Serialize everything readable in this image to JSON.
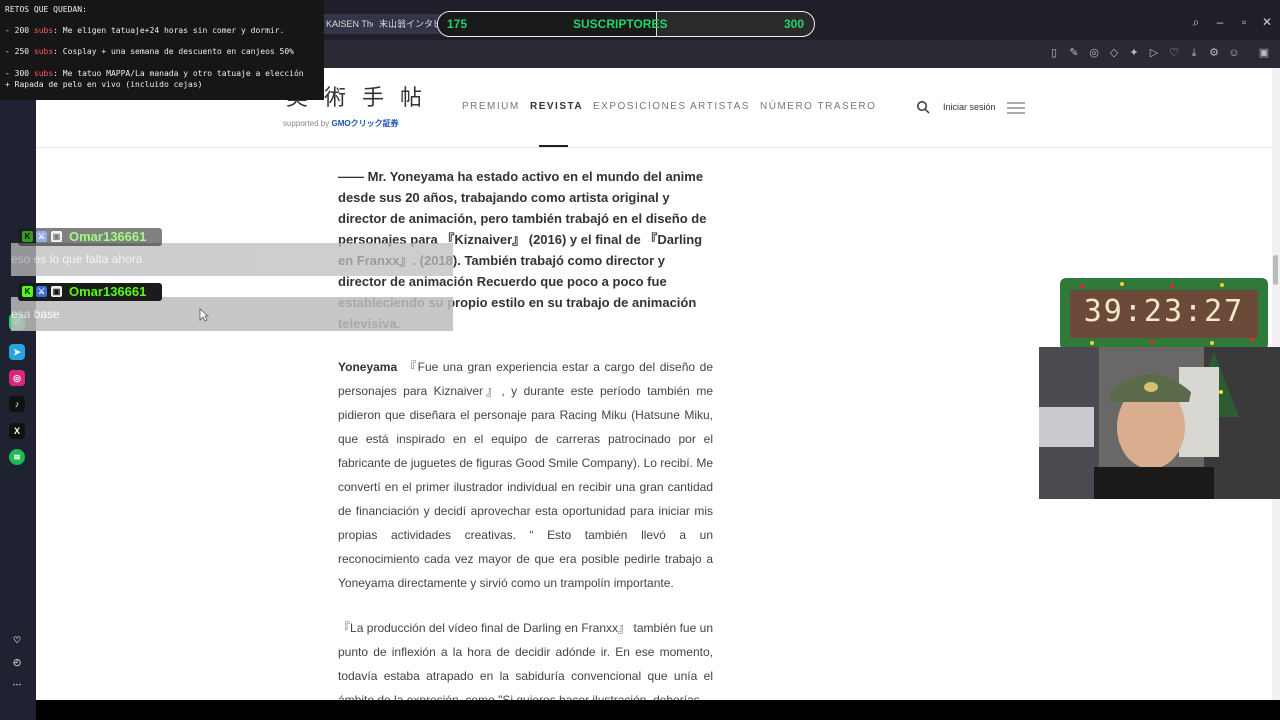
{
  "browser": {
    "tabs": [
      "KAISEN The",
      "末山翁インタビ"
    ],
    "url_fragment": "31760"
  },
  "overlay": {
    "retos_title": "RETOS QUE QUEDAN:",
    "retos": [
      {
        "prefix": "- 200 ",
        "subs": "subs",
        "text": ": Me eligen tatuaje+24 horas sin comer y dormir."
      },
      {
        "prefix": "- 250 ",
        "subs": "subs",
        "text": ": Cosplay + una semana de descuento en canjeos 50%"
      },
      {
        "prefix": "- 300 ",
        "subs": "subs",
        "text": ": Me tatuo MAPPA/La manada y otro tatuaje a elección"
      }
    ],
    "retos_extra": "+ Rapada de pelo en vivo (incluido cejas)",
    "subs_current": "175",
    "subs_label": "SUSCRIPTORES",
    "subs_goal": "300",
    "subs_progress": 0.58,
    "timer": "39:23:27"
  },
  "chat": [
    {
      "user": "Omar136661",
      "text": "eso es lo que falta ahora"
    },
    {
      "user": "Omar136661",
      "text": "esa base"
    }
  ],
  "page": {
    "logo": "美術手帖",
    "supported_by": "supported by",
    "sponsor": "GMOクリック証券",
    "nav": [
      "PREMIUM",
      "REVISTA",
      "EXPOSICIONES",
      "ARTISTAS",
      "NÚMERO TRASERO"
    ],
    "login": "Iniciar sesión",
    "lead": "—— Mr. Yoneyama ha estado activo en el mundo del anime desde sus 20 años, trabajando como artista original y director de animación, pero también trabajó en el diseño de personajes para 『Kiznaiver』 (2016) y el final de 『Darling en Franxx』. (2018). También trabajó como director y director de animación Recuerdo que poco a poco fue estableciendo su propio estilo en su trabajo de animación televisiva.",
    "para1_speaker": "Yoneyama",
    "para1": "『Fue una gran experiencia estar a cargo del diseño de personajes para Kiznaiver』, y durante este período también me pidieron que diseñara el personaje para Racing Miku (Hatsune Miku, que está inspirado en el equipo de carreras patrocinado por el fabricante de juguetes de figuras Good Smile Company). Lo recibí. Me convertí en el primer ilustrador individual en recibir una gran cantidad de financiación y decidí aprovechar esta oportunidad para iniciar mis propias actividades creativas. “ Esto también llevó a un reconocimiento cada vez mayor de que era posible pedirle trabajo a Yoneyama directamente y sirvió como un trampolín importante.",
    "para2": "『La producción del vídeo final de Darling en Franxx』 también fue un punto de inflexión a la hora de decidir adónde ir. En ese momento, todavía estaba atrapado en la sabiduría convencional que unía el ámbito de la expresión, como \"Si quieres hacer ilustración, deberías"
  },
  "colors": {
    "kick_green": "#53fc18",
    "subs_green": "#22d46a",
    "subs_red": "#ff5a5a"
  }
}
